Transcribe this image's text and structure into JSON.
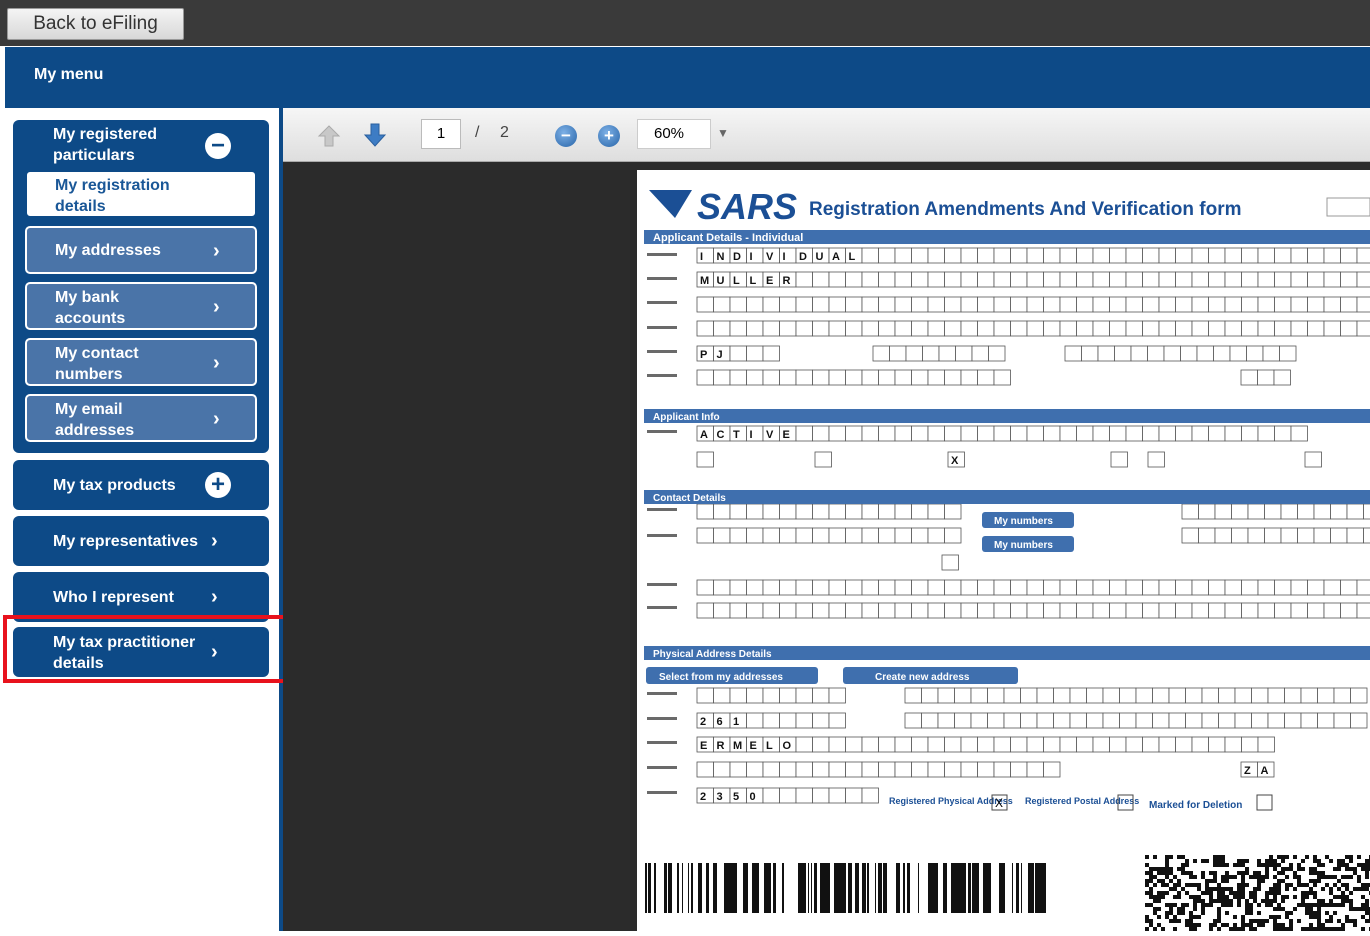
{
  "topbar": {
    "back_label": "Back to eFiling"
  },
  "menubar": {
    "title": "My menu"
  },
  "sidebar": {
    "registered": {
      "label": "My registered particulars",
      "icon": "minus-circle-icon"
    },
    "sub_items": [
      {
        "label": "My registration details",
        "active": true
      },
      {
        "label": "My addresses"
      },
      {
        "label": "My bank accounts"
      },
      {
        "label": "My contact numbers"
      },
      {
        "label": "My email addresses"
      }
    ],
    "tax_products": {
      "label": "My tax products",
      "icon": "plus-circle-icon"
    },
    "representatives": {
      "label": "My representatives"
    },
    "who_represent": {
      "label": "Who I represent"
    },
    "tax_practitioner": {
      "label": "My tax practitioner details"
    }
  },
  "viewer": {
    "page_current": "1",
    "page_sep": "/",
    "page_total": "2",
    "zoom": "60%"
  },
  "form": {
    "logo": "SARS",
    "title": "Registration Amendments And Verification form",
    "section_applicant": "Applicant Details - Individual",
    "nature": "INDIVIDUAL",
    "surname": "MULLER",
    "initials": "PJ",
    "section_info": "Applicant Info",
    "entity_status": "ACTIVE",
    "section_contact": "Contact Details",
    "my_numbers": "My numbers",
    "section_physical": "Physical Address Details",
    "select_addresses": "Select from my addresses",
    "create_address": "Create new address",
    "street_no": "261",
    "suburb": "ERMELO",
    "country_code": "ZA",
    "postal_code": "2350",
    "registered_physical": "Registered Physical Address",
    "registered_postal": "Registered Postal Address",
    "marked_deletion": "Marked for Deletion"
  },
  "colors": {
    "primary": "#0d4a87",
    "sub_item": "#4a74a8",
    "highlight": "#e8121d",
    "viewer_bg": "#2b2b2b"
  }
}
